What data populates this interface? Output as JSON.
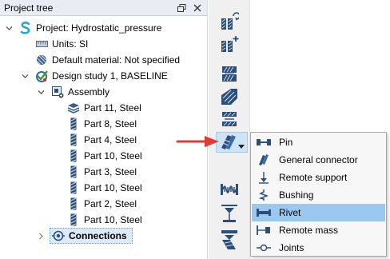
{
  "panel": {
    "title": "Project tree"
  },
  "tree": {
    "project": "Project: Hydrostatic_pressure",
    "units": "Units: SI",
    "default_material": "Default material: Not specified",
    "design_study": "Design study 1, BASELINE",
    "assembly": "Assembly",
    "parts": [
      "Part 11, Steel",
      "Part 8, Steel",
      "Part 4, Steel",
      "Part 10, Steel",
      "Part 3, Steel",
      "Part 10, Steel",
      "Part 2, Steel",
      "Part 10, Steel"
    ],
    "connections": "Connections"
  },
  "menu": {
    "items": [
      {
        "label": "Pin",
        "icon": "pin-icon"
      },
      {
        "label": "General connector",
        "icon": "general-connector-icon"
      },
      {
        "label": "Remote support",
        "icon": "remote-support-icon"
      },
      {
        "label": "Bushing",
        "icon": "bushing-icon"
      },
      {
        "label": "Rivet",
        "icon": "rivet-icon"
      },
      {
        "label": "Remote mass",
        "icon": "remote-mass-icon"
      },
      {
        "label": "Joints",
        "icon": "joints-icon"
      }
    ],
    "highlighted": "Rivet"
  },
  "colors": {
    "highlight": "#9bc8f0",
    "arrow": "#e53935",
    "part_icon": "#2b4f7a"
  }
}
